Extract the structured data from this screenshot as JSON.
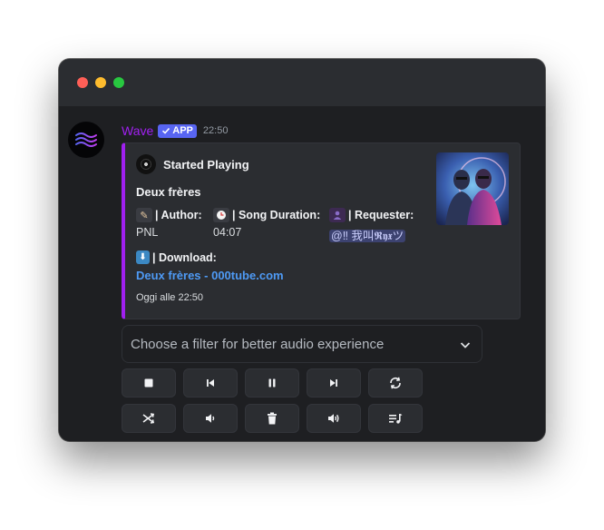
{
  "message": {
    "username": "Wave",
    "badge": "APP",
    "time": "22:50"
  },
  "embed": {
    "author": "Started Playing",
    "title": "Deux frères",
    "fields": {
      "author_label": "| Author:",
      "author_value": "PNL",
      "duration_label": "| Song Duration:",
      "duration_value": "04:07",
      "requester_label": "| Requester:",
      "requester_value": "@‼ 我叫𝕽𝖞𝖝ツ",
      "download_label": "| Download:",
      "download_link": "Deux frères - 000tube.com"
    },
    "footer": "Oggi alle 22:50",
    "accent_color": "#a020f0"
  },
  "filter_select": {
    "placeholder": "Choose a filter for better audio experience"
  },
  "controls": {
    "row1": [
      "stop-icon",
      "previous-icon",
      "pause-icon",
      "next-icon",
      "loop-icon"
    ],
    "row2": [
      "shuffle-icon",
      "volume-down-icon",
      "delete-icon",
      "volume-up-icon",
      "queue-icon"
    ]
  }
}
